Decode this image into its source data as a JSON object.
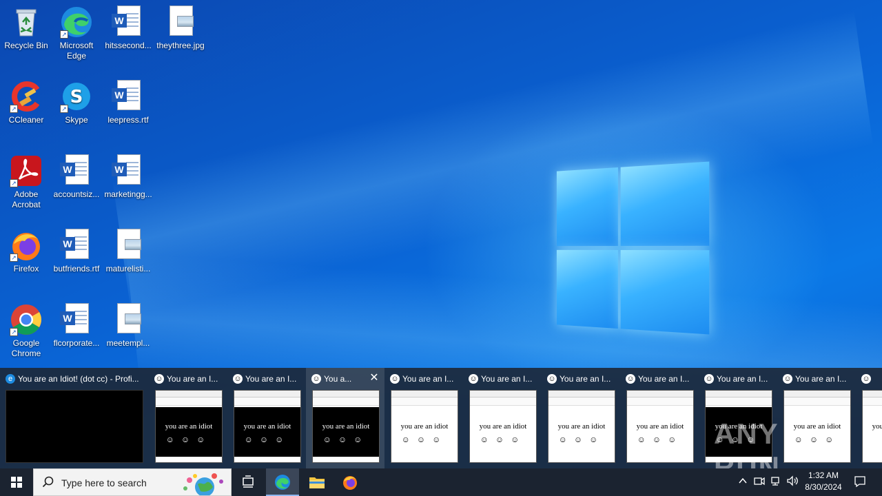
{
  "desktop": {
    "icons": [
      {
        "label": "Recycle Bin",
        "icon": "recycle-bin-icon"
      },
      {
        "label": "Microsoft Edge",
        "icon": "edge-icon"
      },
      {
        "label": "hitssecond...",
        "icon": "word-document-icon"
      },
      {
        "label": "theythree.jpg",
        "icon": "image-file-icon"
      },
      {
        "label": "CCleaner",
        "icon": "ccleaner-icon"
      },
      {
        "label": "Skype",
        "icon": "skype-icon"
      },
      {
        "label": "leepress.rtf",
        "icon": "word-document-icon"
      },
      {
        "label": "Adobe Acrobat",
        "icon": "acrobat-icon"
      },
      {
        "label": "accountsiz...",
        "icon": "word-document-icon"
      },
      {
        "label": "marketingg...",
        "icon": "word-document-icon"
      },
      {
        "label": "Firefox",
        "icon": "firefox-icon"
      },
      {
        "label": "butfriends.rtf",
        "icon": "word-document-icon"
      },
      {
        "label": "maturelisti...",
        "icon": "image-file-icon"
      },
      {
        "label": "Google Chrome",
        "icon": "chrome-icon"
      },
      {
        "label": "flcorporate...",
        "icon": "word-document-icon"
      },
      {
        "label": "meetempl...",
        "icon": "image-file-icon"
      }
    ]
  },
  "thumbnails": {
    "first_title": "You are an Idiot! (dot cc) - Profi...",
    "window_title": "You are an I...",
    "active_title": "You a...",
    "page_phrase": "you are an idiot",
    "faces": "☺☺☺"
  },
  "taskbar": {
    "search_placeholder": "Type here to search",
    "time": "1:32 AM",
    "date": "8/30/2024"
  },
  "watermark": "ANY RUN",
  "colors": {
    "taskbar": "#1b2330",
    "desktop_blue": "#0a63d4",
    "accent": "#8fb7f0"
  }
}
